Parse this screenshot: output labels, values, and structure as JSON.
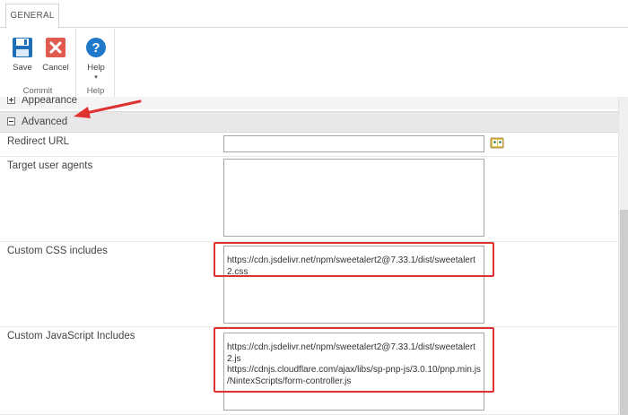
{
  "ribbon": {
    "tab_label": "GENERAL",
    "groups": {
      "commit": {
        "label": "Commit",
        "save_label": "Save",
        "cancel_label": "Cancel"
      },
      "help": {
        "label": "Help",
        "help_label": "Help",
        "dropdown_glyph": "▾"
      }
    }
  },
  "sections": {
    "appearance": "Appearance",
    "advanced": "Advanced"
  },
  "fields": {
    "redirect_url": {
      "label": "Redirect URL",
      "value": ""
    },
    "target_user_agents": {
      "label": "Target user agents",
      "value": ""
    },
    "custom_css": {
      "label": "Custom CSS includes",
      "value": "https://cdn.jsdelivr.net/npm/sweetalert2@7.33.1/dist/sweetalert2.css"
    },
    "custom_js": {
      "label": "Custom JavaScript Includes",
      "value": "https://cdn.jsdelivr.net/npm/sweetalert2@7.33.1/dist/sweetalert2.js\nhttps://cdnjs.cloudflare.com/ajax/libs/sp-pnp-js/3.0.10/pnp.min.js\n/NintexScripts/form-controller.js"
    }
  },
  "icons": {
    "save": "save-icon",
    "cancel": "cancel-icon",
    "help": "help-icon",
    "address_book": "address-book-icon"
  },
  "colors": {
    "highlight": "#e03131",
    "save_blue": "#1f6fb8",
    "cancel_red": "#e05a4f",
    "help_blue": "#1f78c8"
  }
}
